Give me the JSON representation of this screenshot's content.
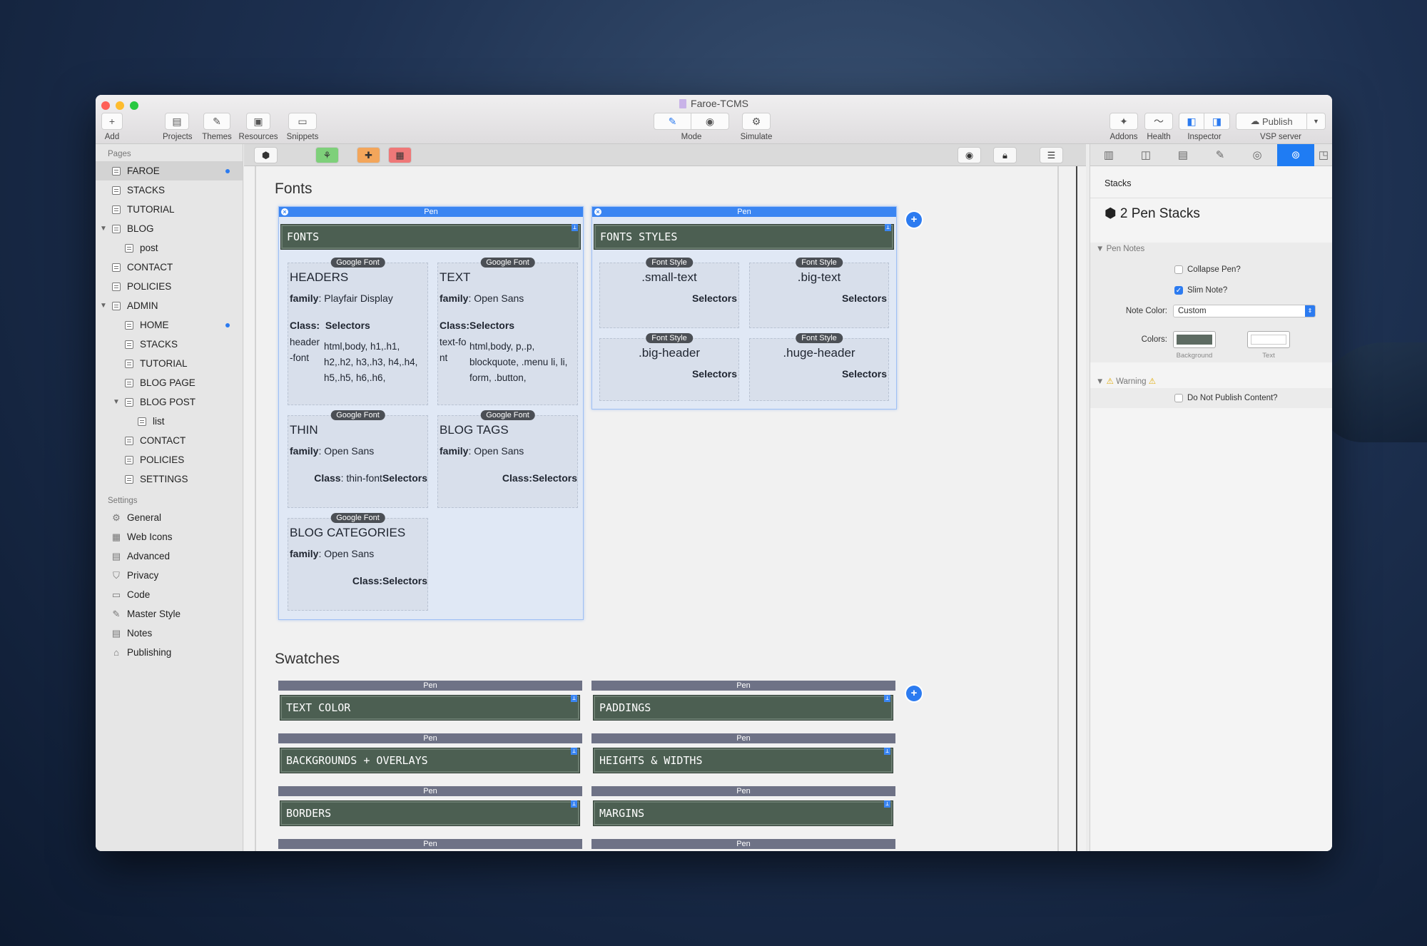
{
  "window": {
    "title": "Faroe-TCMS"
  },
  "toolbar": {
    "add": "Add",
    "projects": "Projects",
    "themes": "Themes",
    "resources": "Resources",
    "snippets": "Snippets",
    "mode": "Mode",
    "simulate": "Simulate",
    "addons": "Addons",
    "health": "Health",
    "inspector": "Inspector",
    "publish": "Publish",
    "vsp": "VSP server"
  },
  "sidebar": {
    "pages_header": "Pages",
    "settings_header": "Settings",
    "pages": [
      {
        "label": "FAROE"
      },
      {
        "label": "STACKS"
      },
      {
        "label": "TUTORIAL"
      },
      {
        "label": "BLOG"
      },
      {
        "label": "post"
      },
      {
        "label": "CONTACT"
      },
      {
        "label": "POLICIES"
      },
      {
        "label": "ADMIN"
      },
      {
        "label": "HOME"
      },
      {
        "label": "STACKS"
      },
      {
        "label": "TUTORIAL"
      },
      {
        "label": "BLOG PAGE"
      },
      {
        "label": "BLOG POST"
      },
      {
        "label": "list"
      },
      {
        "label": "CONTACT"
      },
      {
        "label": "POLICIES"
      },
      {
        "label": "SETTINGS"
      }
    ],
    "settings": [
      {
        "label": "General",
        "icon": "gear-icon"
      },
      {
        "label": "Web Icons",
        "icon": "web-icons-icon"
      },
      {
        "label": "Advanced",
        "icon": "advanced-icon"
      },
      {
        "label": "Privacy",
        "icon": "shield-icon"
      },
      {
        "label": "Code",
        "icon": "code-icon"
      },
      {
        "label": "Master Style",
        "icon": "brush-icon"
      },
      {
        "label": "Notes",
        "icon": "notes-icon"
      },
      {
        "label": "Publishing",
        "icon": "folder-icon"
      }
    ]
  },
  "canvas": {
    "fonts_heading": "Fonts",
    "swatches_heading": "Swatches",
    "pen_label": "Pen",
    "fonts_title": "FONTS",
    "fonts_styles_title": "FONTS STYLES",
    "google_font": "Google Font",
    "font_style": "Font Style",
    "font_cards": [
      {
        "title": "HEADERS",
        "family_label": "family",
        "family": ": Playfair Display",
        "class_label": "Class:",
        "selectors": "Selectors",
        "class_name": "header-font",
        "selector_list": "html,body, h1,.h1, h2,.h2, h3,.h3, h4,.h4, h5,.h5, h6,.h6,"
      },
      {
        "title": "TEXT",
        "family_label": "family",
        "family": ": Open Sans",
        "class_label": "Class:",
        "selectors": "Selectors",
        "class_name": "text-font",
        "selector_list": "html,body, p,.p, blockquote, .menu li, li, form, .button,"
      },
      {
        "title": "THIN",
        "family_label": "family",
        "family": ": Open Sans",
        "class_label": "Class",
        "class_name": ": thin-font",
        "selectors": "Selectors"
      },
      {
        "title": "BLOG TAGS",
        "family_label": "family",
        "family": ": Open Sans",
        "class_label": "Class:",
        "selectors": "Selectors"
      },
      {
        "title": "BLOG CATEGORIES",
        "family_label": "family",
        "family": ": Open Sans",
        "class_label": "Class:",
        "selectors": "Selectors"
      }
    ],
    "style_cards": [
      {
        "title": ".small-text",
        "selectors": "Selectors"
      },
      {
        "title": ".big-text",
        "selectors": "Selectors"
      },
      {
        "title": ".big-header",
        "selectors": "Selectors"
      },
      {
        "title": ".huge-header",
        "selectors": "Selectors"
      }
    ],
    "swatches": [
      "TEXT COLOR",
      "PADDINGS",
      "BACKGROUNDS + OVERLAYS",
      "HEIGHTS & WIDTHS",
      "BORDERS",
      "MARGINS"
    ]
  },
  "inspector": {
    "section": "Stacks",
    "heading": "2 Pen Stacks",
    "pen_notes": "Pen Notes",
    "collapse_pen": "Collapse Pen?",
    "slim_note": "Slim Note?",
    "note_color_label": "Note Color:",
    "note_color_value": "Custom",
    "colors_label": "Colors:",
    "background": "Background",
    "text": "Text",
    "warning": "Warning",
    "do_not_publish": "Do Not Publish Content?",
    "swatch_bg": "#5d6b62",
    "swatch_text": "#ffffff"
  }
}
